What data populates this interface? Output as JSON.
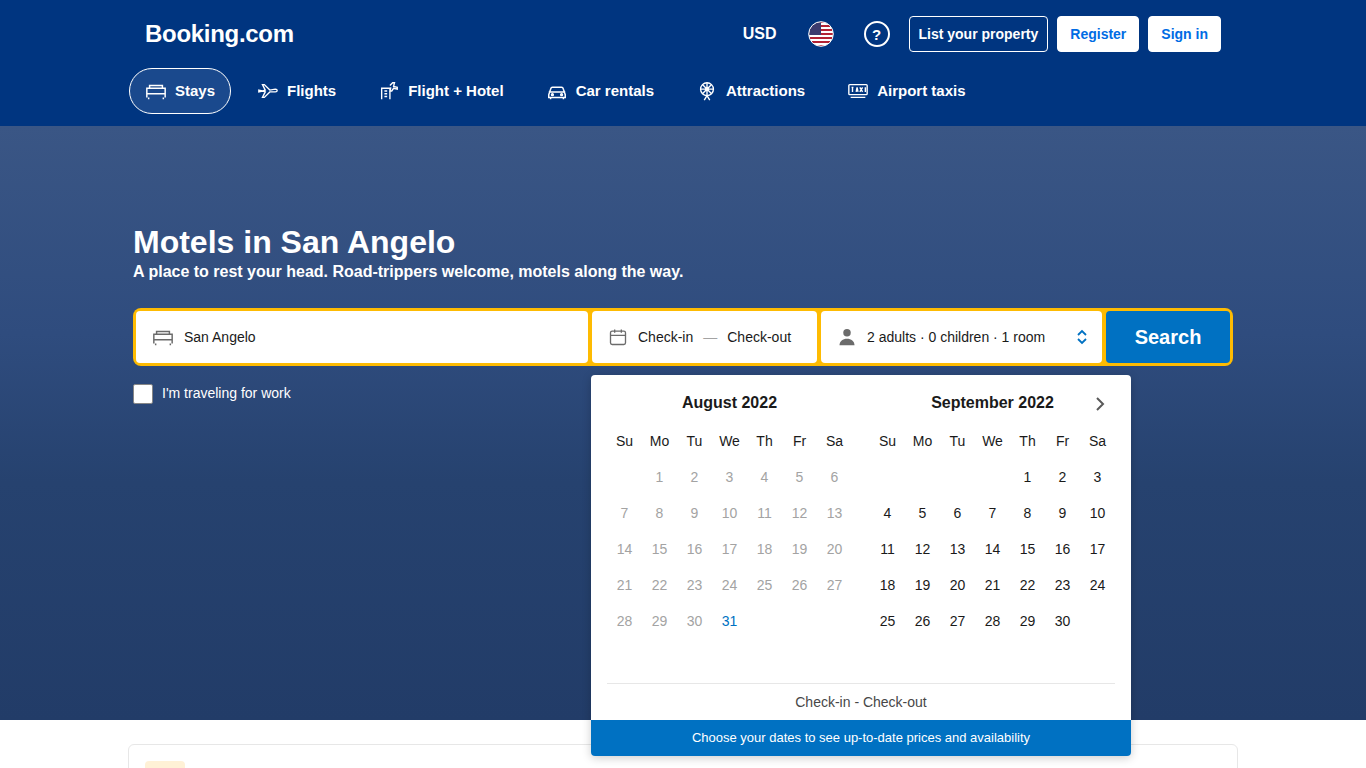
{
  "header": {
    "logo": "Booking.com",
    "currency": "USD",
    "help": "?",
    "buttons": [
      {
        "label": "List your property",
        "kind": "outline"
      },
      {
        "label": "Register",
        "kind": "solid"
      },
      {
        "label": "Sign in",
        "kind": "solid"
      }
    ]
  },
  "nav": [
    {
      "label": "Stays",
      "selected": true
    },
    {
      "label": "Flights",
      "selected": false
    },
    {
      "label": "Flight + Hotel",
      "selected": false
    },
    {
      "label": "Car rentals",
      "selected": false
    },
    {
      "label": "Attractions",
      "selected": false
    },
    {
      "label": "Airport taxis",
      "selected": false
    }
  ],
  "hero": {
    "title": "Motels in San Angelo",
    "subtitle": "A place to rest your head. Road-trippers welcome, motels along the way."
  },
  "search": {
    "destination": "San Angelo",
    "check_in": "Check-in",
    "separator": "—",
    "check_out": "Check-out",
    "guests": "2 adults · 0 children · 1 room",
    "button": "Search"
  },
  "work_trip": {
    "label": "I'm traveling for work",
    "checked": false
  },
  "calendar": {
    "months": [
      {
        "title": "August 2022",
        "weekdays": [
          "Su",
          "Mo",
          "Tu",
          "We",
          "Th",
          "Fr",
          "Sa"
        ],
        "weeks": [
          [
            null,
            {
              "day": "1",
              "disabled": true,
              "today": false
            },
            {
              "day": "2",
              "disabled": true,
              "today": false
            },
            {
              "day": "3",
              "disabled": true,
              "today": false
            },
            {
              "day": "4",
              "disabled": true,
              "today": false
            },
            {
              "day": "5",
              "disabled": true,
              "today": false
            },
            {
              "day": "6",
              "disabled": true,
              "today": false
            }
          ],
          [
            {
              "day": "7",
              "disabled": true,
              "today": false
            },
            {
              "day": "8",
              "disabled": true,
              "today": false
            },
            {
              "day": "9",
              "disabled": true,
              "today": false
            },
            {
              "day": "10",
              "disabled": true,
              "today": false
            },
            {
              "day": "11",
              "disabled": true,
              "today": false
            },
            {
              "day": "12",
              "disabled": true,
              "today": false
            },
            {
              "day": "13",
              "disabled": true,
              "today": false
            }
          ],
          [
            {
              "day": "14",
              "disabled": true,
              "today": false
            },
            {
              "day": "15",
              "disabled": true,
              "today": false
            },
            {
              "day": "16",
              "disabled": true,
              "today": false
            },
            {
              "day": "17",
              "disabled": true,
              "today": false
            },
            {
              "day": "18",
              "disabled": true,
              "today": false
            },
            {
              "day": "19",
              "disabled": true,
              "today": false
            },
            {
              "day": "20",
              "disabled": true,
              "today": false
            }
          ],
          [
            {
              "day": "21",
              "disabled": true,
              "today": false
            },
            {
              "day": "22",
              "disabled": true,
              "today": false
            },
            {
              "day": "23",
              "disabled": true,
              "today": false
            },
            {
              "day": "24",
              "disabled": true,
              "today": false
            },
            {
              "day": "25",
              "disabled": true,
              "today": false
            },
            {
              "day": "26",
              "disabled": true,
              "today": false
            },
            {
              "day": "27",
              "disabled": true,
              "today": false
            }
          ],
          [
            {
              "day": "28",
              "disabled": true,
              "today": false
            },
            {
              "day": "29",
              "disabled": true,
              "today": false
            },
            {
              "day": "30",
              "disabled": true,
              "today": false
            },
            {
              "day": "31",
              "disabled": false,
              "today": true
            }
          ]
        ]
      },
      {
        "title": "September 2022",
        "weekdays": [
          "Su",
          "Mo",
          "Tu",
          "We",
          "Th",
          "Fr",
          "Sa"
        ],
        "weeks": [
          [
            null,
            null,
            null,
            null,
            {
              "day": "1",
              "disabled": false,
              "today": false
            },
            {
              "day": "2",
              "disabled": false,
              "today": false
            },
            {
              "day": "3",
              "disabled": false,
              "today": false
            }
          ],
          [
            {
              "day": "4",
              "disabled": false,
              "today": false
            },
            {
              "day": "5",
              "disabled": false,
              "today": false
            },
            {
              "day": "6",
              "disabled": false,
              "today": false
            },
            {
              "day": "7",
              "disabled": false,
              "today": false
            },
            {
              "day": "8",
              "disabled": false,
              "today": false
            },
            {
              "day": "9",
              "disabled": false,
              "today": false
            },
            {
              "day": "10",
              "disabled": false,
              "today": false
            }
          ],
          [
            {
              "day": "11",
              "disabled": false,
              "today": false
            },
            {
              "day": "12",
              "disabled": false,
              "today": false
            },
            {
              "day": "13",
              "disabled": false,
              "today": false
            },
            {
              "day": "14",
              "disabled": false,
              "today": false
            },
            {
              "day": "15",
              "disabled": false,
              "today": false
            },
            {
              "day": "16",
              "disabled": false,
              "today": false
            },
            {
              "day": "17",
              "disabled": false,
              "today": false
            }
          ],
          [
            {
              "day": "18",
              "disabled": false,
              "today": false
            },
            {
              "day": "19",
              "disabled": false,
              "today": false
            },
            {
              "day": "20",
              "disabled": false,
              "today": false
            },
            {
              "day": "21",
              "disabled": false,
              "today": false
            },
            {
              "day": "22",
              "disabled": false,
              "today": false
            },
            {
              "day": "23",
              "disabled": false,
              "today": false
            },
            {
              "day": "24",
              "disabled": false,
              "today": false
            }
          ],
          [
            {
              "day": "25",
              "disabled": false,
              "today": false
            },
            {
              "day": "26",
              "disabled": false,
              "today": false
            },
            {
              "day": "27",
              "disabled": false,
              "today": false
            },
            {
              "day": "28",
              "disabled": false,
              "today": false
            },
            {
              "day": "29",
              "disabled": false,
              "today": false
            },
            {
              "day": "30",
              "disabled": false,
              "today": false
            }
          ]
        ]
      }
    ],
    "footer": "Check-in - Check-out",
    "banner": "Choose your dates to see up-to-date prices and availability"
  }
}
